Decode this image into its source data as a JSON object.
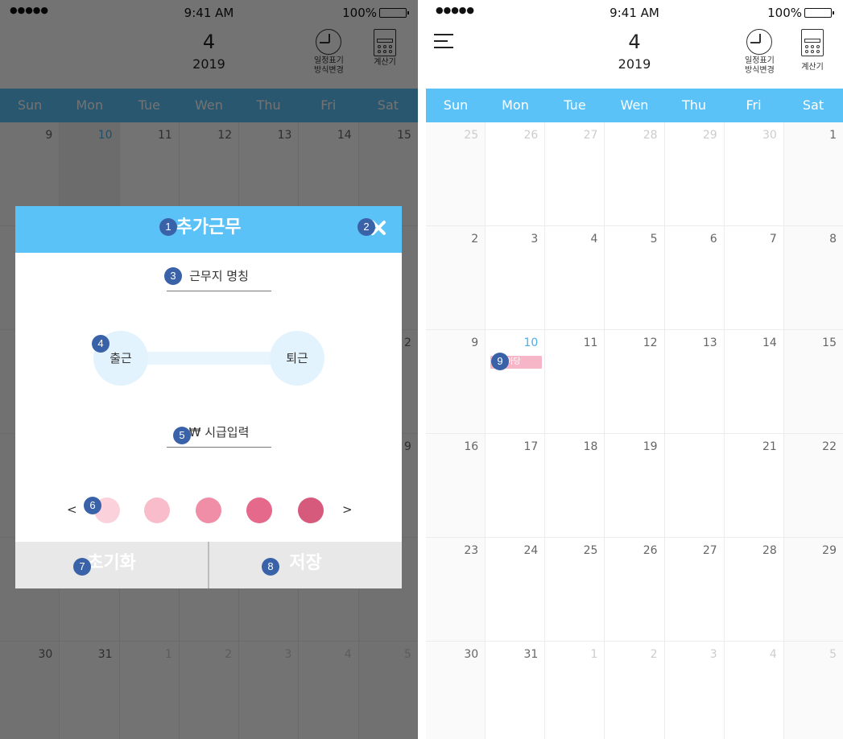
{
  "status": {
    "dots": "●●●●●",
    "time": "9:41 AM",
    "battery": "100%"
  },
  "calendar": {
    "month": "4",
    "year": "2019",
    "view_toggle_label": "일정표기\n방식변경",
    "calculator_label": "계산기",
    "weekdays": [
      "Sun",
      "Mon",
      "Tue",
      "Wen",
      "Thu",
      "Fri",
      "Sat"
    ],
    "weeks": [
      [
        "25",
        "26",
        "27",
        "28",
        "29",
        "30",
        "1"
      ],
      [
        "2",
        "3",
        "4",
        "5",
        "6",
        "7",
        "8"
      ],
      [
        "9",
        "10",
        "11",
        "12",
        "13",
        "14",
        "15"
      ],
      [
        "16",
        "17",
        "18",
        "19",
        "",
        "21",
        "22"
      ],
      [
        "23",
        "24",
        "25",
        "26",
        "27",
        "28",
        "29"
      ],
      [
        "30",
        "31",
        "1",
        "2",
        "3",
        "4",
        "5"
      ]
    ],
    "left_weeks": [
      [
        "9",
        "10",
        "11",
        "12",
        "13",
        "14",
        "15"
      ],
      [
        "",
        "",
        "",
        "",
        "",
        "",
        ""
      ],
      [
        "",
        "",
        "",
        "",
        "",
        "",
        "2"
      ],
      [
        "",
        "",
        "",
        "",
        "",
        "",
        "9"
      ],
      [
        "",
        "",
        "",
        "",
        "",
        "",
        ""
      ],
      [
        "30",
        "31",
        "1",
        "2",
        "3",
        "4",
        "5"
      ]
    ],
    "event_label": "위아당",
    "today": "10"
  },
  "modal": {
    "title": "추가근무",
    "place_placeholder": "근무지 명칭",
    "clock_in": "출근",
    "clock_out": "퇴근",
    "wage_placeholder": "₩ 시급입력",
    "prev_arrow": "<",
    "next_arrow": ">",
    "swatch_colors": [
      "#fbd1dc",
      "#f9bccb",
      "#ef8ea6",
      "#e4698a",
      "#d65a7b"
    ],
    "reset_label": "초기화",
    "save_label": "저장"
  },
  "markers": [
    "1",
    "2",
    "3",
    "4",
    "5",
    "6",
    "7",
    "8",
    "9"
  ],
  "colors": {
    "accent": "#5bc2f7",
    "marker": "#3a62a8",
    "event": "#f7b6c8",
    "today_text": "#4aaee8"
  }
}
